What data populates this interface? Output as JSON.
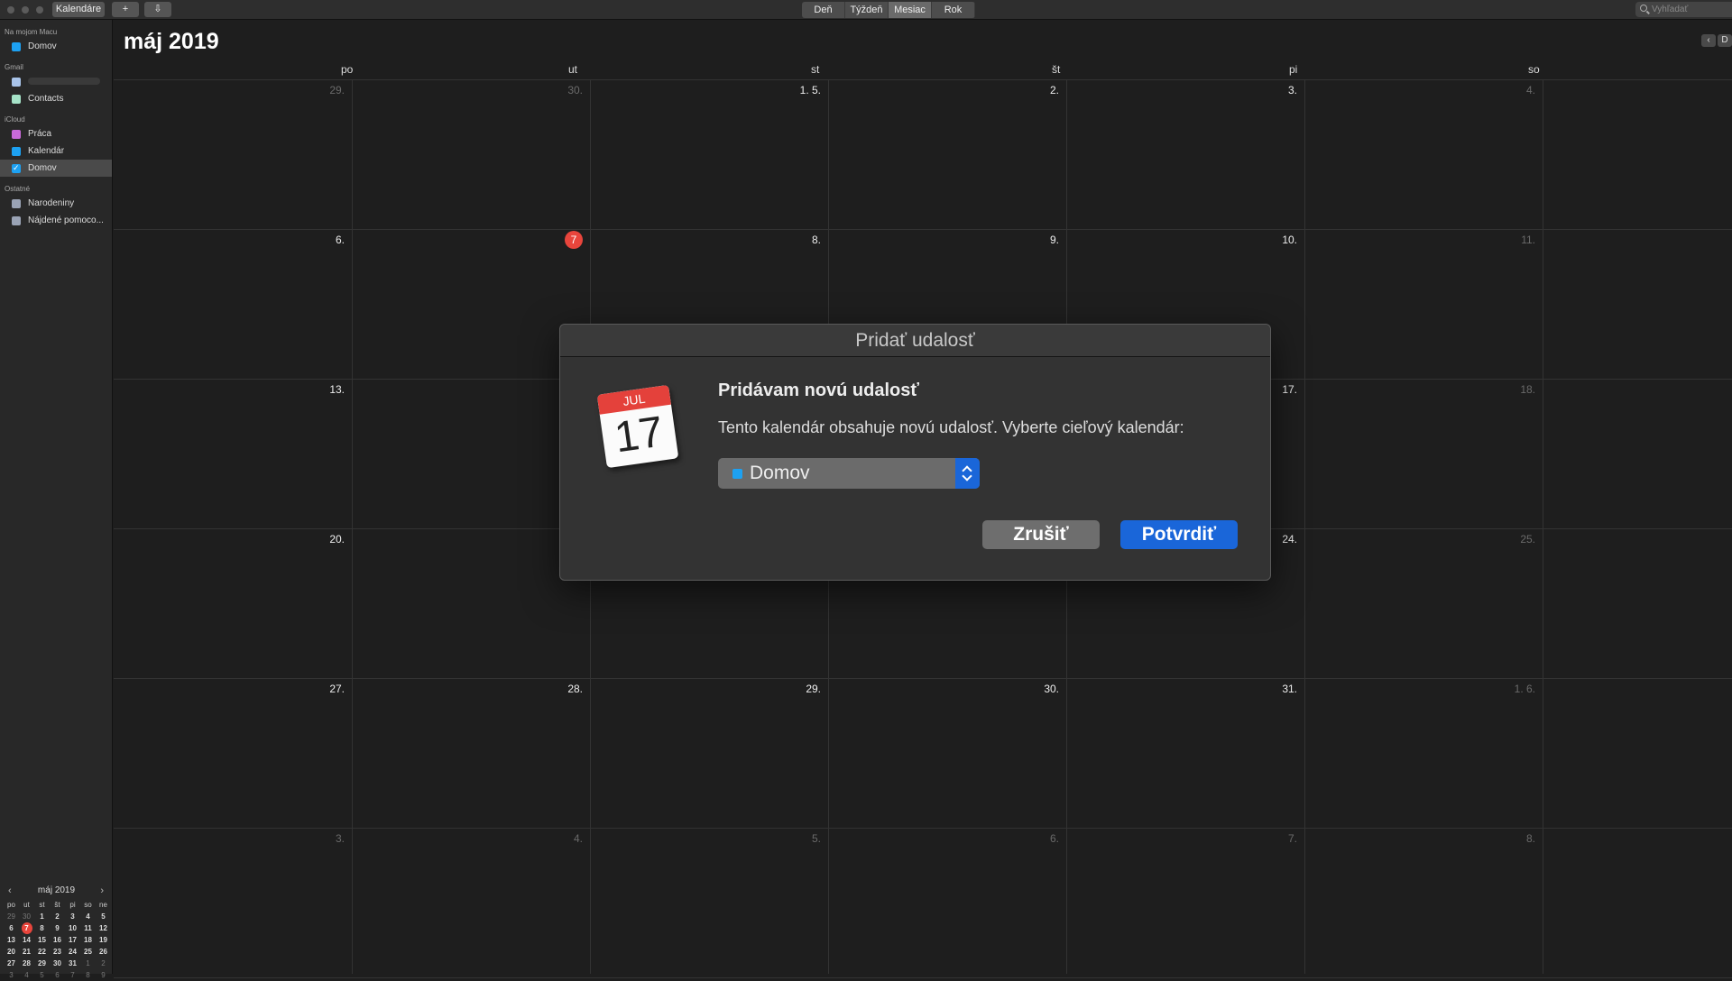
{
  "toolbar": {
    "calendars_button": "Kalendáre",
    "add_icon": "+",
    "download_icon": "⇩",
    "views": [
      "Deň",
      "Týždeň",
      "Mesiac",
      "Rok"
    ],
    "active_view": "Mesiac",
    "search_placeholder": "Vyhľadať"
  },
  "sidebar": {
    "groups": [
      {
        "title": "Na mojom Macu",
        "items": [
          {
            "label": "Domov",
            "color": "#1da1f2",
            "checked": false,
            "selected": false
          }
        ]
      },
      {
        "title": "Gmail",
        "items": [
          {
            "label": "",
            "color": "#a9c4ea",
            "checked": false,
            "selected": false,
            "blurred": true
          },
          {
            "label": "Contacts",
            "color": "#a6e3c8",
            "checked": false,
            "selected": false
          }
        ]
      },
      {
        "title": "iCloud",
        "items": [
          {
            "label": "Práca",
            "color": "#c86ad9",
            "checked": false,
            "selected": false
          },
          {
            "label": "Kalendár",
            "color": "#1da1f2",
            "checked": false,
            "selected": false
          },
          {
            "label": "Domov",
            "color": "#1da1f2",
            "checked": true,
            "selected": true
          }
        ]
      },
      {
        "title": "Ostatné",
        "items": [
          {
            "label": "Narodeniny",
            "color": "#9aa3b5",
            "checked": false,
            "selected": false
          },
          {
            "label": "Nájdené pomoco...",
            "color": "#9aa3b5",
            "checked": false,
            "selected": false
          }
        ]
      }
    ]
  },
  "mini_calendar": {
    "title": "máj 2019",
    "prev": "‹",
    "next": "›",
    "dow": [
      "po",
      "ut",
      "st",
      "št",
      "pi",
      "so",
      "ne"
    ],
    "weeks": [
      [
        [
          "29",
          "dim"
        ],
        [
          "30",
          "dim"
        ],
        [
          "1",
          ""
        ],
        [
          "2",
          ""
        ],
        [
          "3",
          ""
        ],
        [
          "4",
          ""
        ],
        [
          "5",
          ""
        ]
      ],
      [
        [
          "6",
          ""
        ],
        [
          "7",
          "today"
        ],
        [
          "8",
          ""
        ],
        [
          "9",
          ""
        ],
        [
          "10",
          ""
        ],
        [
          "11",
          ""
        ],
        [
          "12",
          ""
        ]
      ],
      [
        [
          "13",
          ""
        ],
        [
          "14",
          ""
        ],
        [
          "15",
          ""
        ],
        [
          "16",
          ""
        ],
        [
          "17",
          ""
        ],
        [
          "18",
          ""
        ],
        [
          "19",
          ""
        ]
      ],
      [
        [
          "20",
          ""
        ],
        [
          "21",
          ""
        ],
        [
          "22",
          ""
        ],
        [
          "23",
          ""
        ],
        [
          "24",
          ""
        ],
        [
          "25",
          ""
        ],
        [
          "26",
          ""
        ]
      ],
      [
        [
          "27",
          ""
        ],
        [
          "28",
          ""
        ],
        [
          "29",
          ""
        ],
        [
          "30",
          ""
        ],
        [
          "31",
          ""
        ],
        [
          "1",
          "dim"
        ],
        [
          "2",
          "dim"
        ]
      ],
      [
        [
          "3",
          "dim"
        ],
        [
          "4",
          "dim"
        ],
        [
          "5",
          "dim"
        ],
        [
          "6",
          "dim"
        ],
        [
          "7",
          "dim"
        ],
        [
          "8",
          "dim"
        ],
        [
          "9",
          "dim"
        ]
      ]
    ]
  },
  "month_view": {
    "title": "máj 2019",
    "nav_prev": "‹",
    "nav_next": "D",
    "dow": [
      "po",
      "ut",
      "st",
      "št",
      "pi",
      "so"
    ],
    "weeks": [
      [
        [
          "29.",
          "dim"
        ],
        [
          "30.",
          "dim"
        ],
        [
          "1. 5.",
          ""
        ],
        [
          "2.",
          ""
        ],
        [
          "3.",
          ""
        ],
        [
          "4.",
          "dim"
        ]
      ],
      [
        [
          "6.",
          ""
        ],
        [
          ".",
          "today"
        ],
        [
          "8.",
          ""
        ],
        [
          "9.",
          ""
        ],
        [
          "10.",
          ""
        ],
        [
          "11.",
          "dim"
        ]
      ],
      [
        [
          "13.",
          ""
        ],
        [
          "",
          ""
        ],
        [
          "",
          ""
        ],
        [
          "",
          ""
        ],
        [
          "17.",
          ""
        ],
        [
          "18.",
          "dim"
        ]
      ],
      [
        [
          "20.",
          ""
        ],
        [
          "",
          ""
        ],
        [
          "",
          ""
        ],
        [
          "",
          ""
        ],
        [
          "24.",
          ""
        ],
        [
          "25.",
          "dim"
        ]
      ],
      [
        [
          "27.",
          ""
        ],
        [
          "28.",
          ""
        ],
        [
          "29.",
          ""
        ],
        [
          "30.",
          ""
        ],
        [
          "31.",
          ""
        ],
        [
          "1. 6.",
          "dim"
        ]
      ],
      [
        [
          "3.",
          "dim"
        ],
        [
          "4.",
          "dim"
        ],
        [
          "5.",
          "dim"
        ],
        [
          "6.",
          "dim"
        ],
        [
          "7.",
          "dim"
        ],
        [
          "8.",
          "dim"
        ]
      ]
    ],
    "today_number": "7"
  },
  "dialog": {
    "title": "Pridať udalosť",
    "icon_month": "JUL",
    "icon_day": "17",
    "heading": "Pridávam novú udalosť",
    "message": "Tento kalendár obsahuje novú udalosť. Vyberte cieľový kalendár:",
    "selected_calendar": "Domov",
    "selected_color": "#1da1f2",
    "cancel_label": "Zrušiť",
    "confirm_label": "Potvrdiť"
  }
}
